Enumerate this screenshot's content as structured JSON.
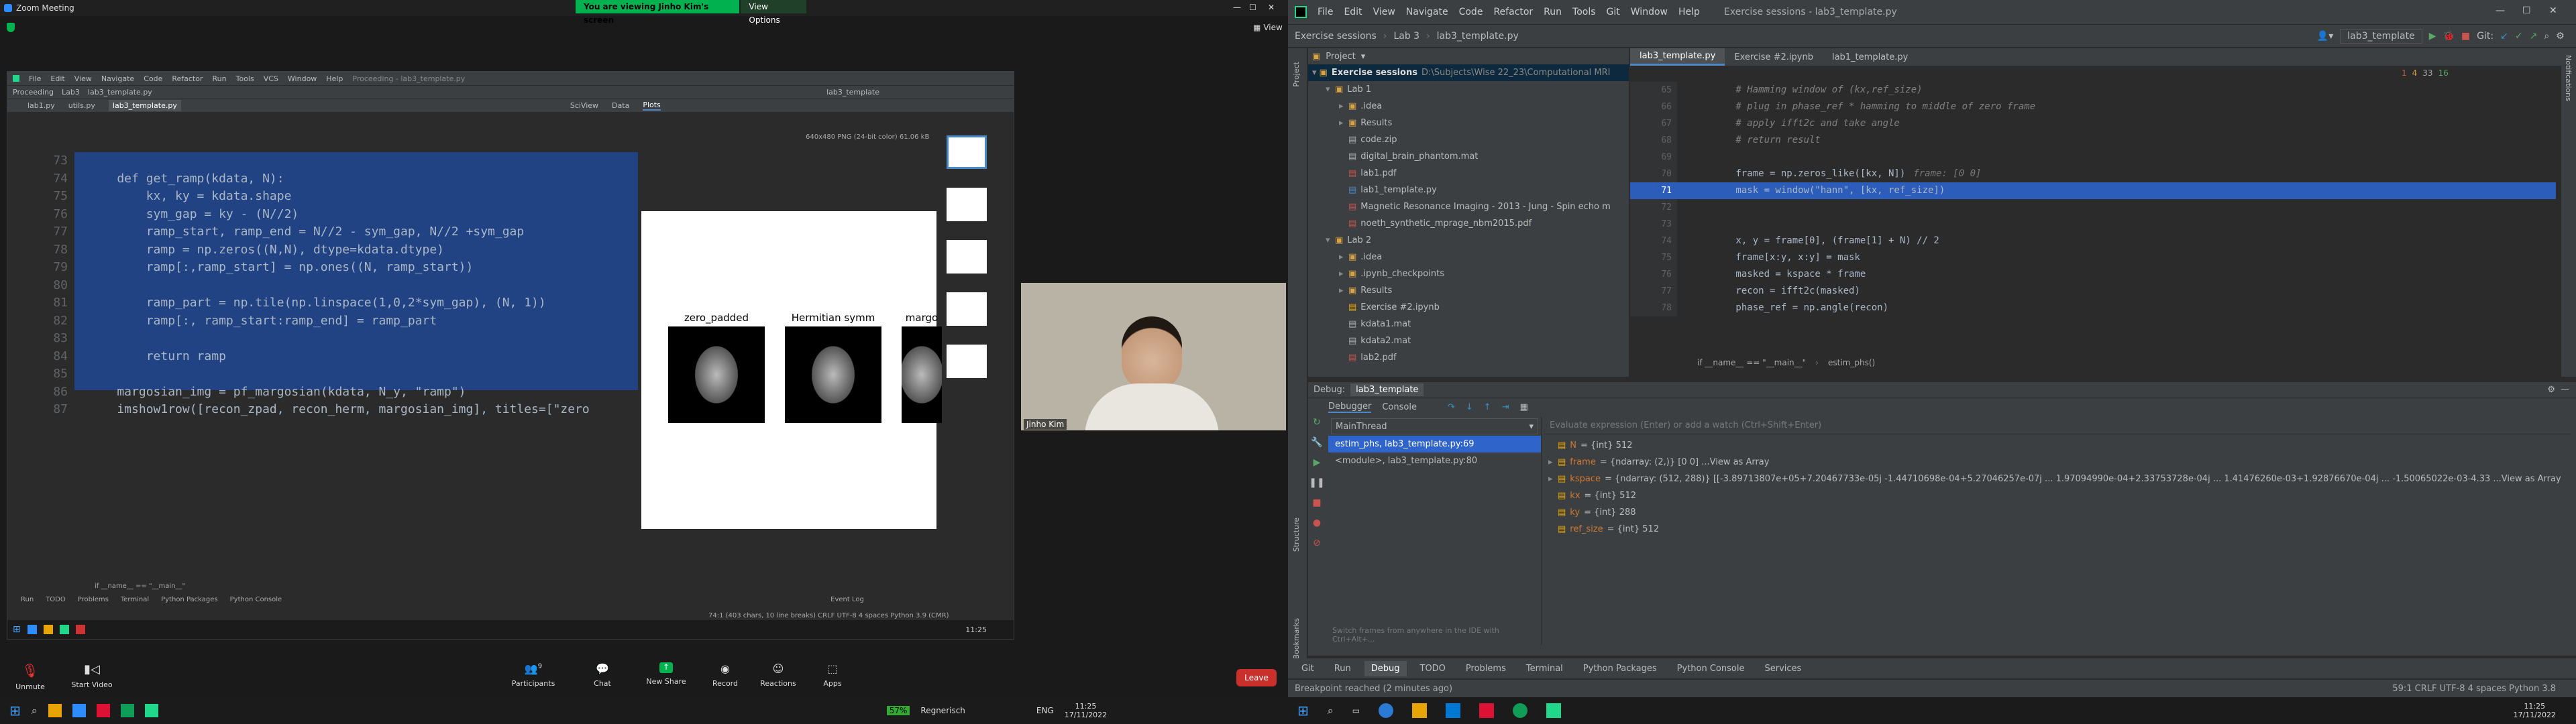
{
  "zoom": {
    "window_title": "Zoom Meeting",
    "banner_text": "You are viewing Jinho Kim's screen",
    "view_options": "View Options",
    "view_label": "View",
    "participant_name": "Jinho Kim",
    "toolbar": {
      "unmute": "Unmute",
      "start_video": "Start Video",
      "participants": "Participants",
      "participants_count": "9",
      "chat": "Chat",
      "share_screen": "New Share",
      "record": "Record",
      "reactions": "Reactions",
      "apps": "Apps",
      "leave": "Leave"
    },
    "shared_ide": {
      "menu": [
        "File",
        "Edit",
        "View",
        "Navigate",
        "Code",
        "Refactor",
        "Run",
        "Tools",
        "VCS",
        "Window",
        "Help"
      ],
      "title": "Proceeding - lab3_template.py",
      "breadcrumb": [
        "Proceeding",
        "Lab3",
        "lab3_template.py"
      ],
      "tabs": [
        "lab1.py",
        "utils.py",
        "lab3_template.py"
      ],
      "run_config": "lab3_template",
      "code_start_line": 73,
      "code": [
        "",
        "    def get_ramp(kdata, N):",
        "        kx, ky = kdata.shape",
        "        sym_gap = ky - (N//2)",
        "        ramp_start, ramp_end = N//2 - sym_gap, N//2 +sym_gap",
        "        ramp = np.zeros((N,N), dtype=kdata.dtype)",
        "        ramp[:,ramp_start] = np.ones((N, ramp_start))",
        "",
        "        ramp_part = np.tile(np.linspace(1,0,2*sym_gap), (N, 1))",
        "        ramp[:, ramp_start:ramp_end] = ramp_part",
        "",
        "        return ramp",
        "",
        "    margosian_img = pf_margosian(kdata, N_y, \"ramp\")",
        "    imshow1row([recon_zpad, recon_herm, margosian_img], titles=[\"zero"
      ],
      "breadcrumb_bottom": "if __name__ == \"__main__\"",
      "sciview_tabs": [
        "SciView",
        "Data",
        "Plots"
      ],
      "plot_info": "640x480 PNG (24-bit color) 61.06 kB",
      "plot_titles": [
        "zero_padded",
        "Hermitian symm",
        "margo"
      ],
      "bottom_tabs": [
        "Run",
        "TODO",
        "Problems",
        "Terminal",
        "Python Packages",
        "Python Console"
      ],
      "status": "74:1 (403 chars, 10 line breaks)   CRLF   UTF-8   4 spaces   Python 3.9 (CMR)",
      "event_log": "Event Log",
      "taskbar_time": "11:25"
    }
  },
  "right_ide": {
    "menu": [
      "File",
      "Edit",
      "View",
      "Navigate",
      "Code",
      "Refactor",
      "Run",
      "Tools",
      "Git",
      "Window",
      "Help"
    ],
    "title": "Exercise sessions - lab3_template.py",
    "breadcrumb": [
      "Exercise sessions",
      "Lab 3",
      "lab3_template.py"
    ],
    "run_config": "lab3_template",
    "git_label": "Git:",
    "project_label": "Project",
    "project_root": "Exercise sessions",
    "project_path": "D:\\Subjects\\Wise 22_23\\Computational MRI",
    "tree": [
      {
        "label": "Lab 1",
        "level": 1,
        "type": "folder",
        "open": true
      },
      {
        "label": ".idea",
        "level": 2,
        "type": "folder",
        "open": false
      },
      {
        "label": "Results",
        "level": 2,
        "type": "folder",
        "open": false
      },
      {
        "label": "code.zip",
        "level": 2,
        "type": "zip"
      },
      {
        "label": "digital_brain_phantom.mat",
        "level": 2,
        "type": "mat"
      },
      {
        "label": "lab1.pdf",
        "level": 2,
        "type": "pdf"
      },
      {
        "label": "lab1_template.py",
        "level": 2,
        "type": "py"
      },
      {
        "label": "Magnetic Resonance Imaging - 2013 - Jung - Spin echo m",
        "level": 2,
        "type": "pdf"
      },
      {
        "label": "noeth_synthetic_mprage_nbm2015.pdf",
        "level": 2,
        "type": "pdf"
      },
      {
        "label": "Lab 2",
        "level": 1,
        "type": "folder",
        "open": true
      },
      {
        "label": ".idea",
        "level": 2,
        "type": "folder",
        "open": false
      },
      {
        "label": ".ipynb_checkpoints",
        "level": 2,
        "type": "folder",
        "open": false
      },
      {
        "label": "Results",
        "level": 2,
        "type": "folder",
        "open": false
      },
      {
        "label": "Exercise #2.ipynb",
        "level": 2,
        "type": "ipynb"
      },
      {
        "label": "kdata1.mat",
        "level": 2,
        "type": "mat"
      },
      {
        "label": "kdata2.mat",
        "level": 2,
        "type": "mat"
      },
      {
        "label": "lab2.pdf",
        "level": 2,
        "type": "pdf"
      }
    ],
    "editor_tabs": [
      "lab3_template.py",
      "Exercise #2.ipynb",
      "lab1_template.py"
    ],
    "inspections": {
      "errors": "1",
      "warnings": "4",
      "weak": "33",
      "typos": "16"
    },
    "code_start_line": 65,
    "code": [
      {
        "text": "        # Hamming window of (kx,ref_size)",
        "cls": "cm"
      },
      {
        "text": "        # plug in phase_ref * hamming to middle of zero frame",
        "cls": "cm"
      },
      {
        "text": "        # apply ifft2c and take angle",
        "cls": "cm"
      },
      {
        "text": "        # return result",
        "cls": "cm"
      },
      {
        "text": "",
        "cls": "var"
      },
      {
        "text": "        frame = np.zeros_like([kx, N])",
        "cls": "var",
        "hint": "frame: [0 0]"
      },
      {
        "text": "        mask = window(\"hann\", [kx, ref_size])",
        "cls": "var",
        "current": true
      },
      {
        "text": "",
        "cls": "var"
      },
      {
        "text": "",
        "cls": "var"
      },
      {
        "text": "        x, y = frame[0], (frame[1] + N) // 2",
        "cls": "var"
      },
      {
        "text": "        frame[x:y, x:y] = mask",
        "cls": "var"
      },
      {
        "text": "        masked = kspace * frame",
        "cls": "var"
      },
      {
        "text": "        recon = ifft2c(masked)",
        "cls": "var"
      },
      {
        "text": "        phase_ref = np.angle(recon)",
        "cls": "var"
      }
    ],
    "editor_breadcrumb": [
      "if __name__ == \"__main__\"",
      "estim_phs()"
    ],
    "debug": {
      "label": "Debug:",
      "config": "lab3_template",
      "tabs": [
        "Debugger",
        "Console"
      ],
      "thread": "MainThread",
      "frames": [
        "estim_phs, lab3_template.py:69",
        "<module>, lab3_template.py:80"
      ],
      "eval_placeholder": "Evaluate expression (Enter) or add a watch (Ctrl+Shift+Enter)",
      "variables": [
        {
          "name": "N",
          "value": "= {int} 512",
          "expandable": false
        },
        {
          "name": "frame",
          "value": "= {ndarray: (2,)} [0 0] ...View as Array",
          "expandable": true
        },
        {
          "name": "kspace",
          "value": "= {ndarray: (512, 288)} [[-3.89713807e+05+7.20467733e-05j -1.44710698e-04+5.27046257e-07j ... 1.97094990e-04+2.33753728e-04j ... 1.41476260e-03+1.92876670e-04j ... -1.50065022e-03-4.33 ...View as Array",
          "expandable": true
        },
        {
          "name": "kx",
          "value": "= {int} 512",
          "expandable": false
        },
        {
          "name": "ky",
          "value": "= {int} 288",
          "expandable": false
        },
        {
          "name": "ref_size",
          "value": "= {int} 512",
          "expandable": false
        }
      ],
      "switch_frames_hint": "Switch frames from anywhere in the IDE with Ctrl+Alt+..."
    },
    "bottom_tabs": [
      "Git",
      "Run",
      "Debug",
      "TODO",
      "Problems",
      "Terminal",
      "Python Packages",
      "Python Console",
      "Services"
    ],
    "status_left": "Breakpoint reached (2 minutes ago)",
    "status_right": "59:1   CRLF   UTF-8   4 spaces   Python 3.8"
  },
  "left_taskbar": {
    "battery": "57%",
    "weather": "Regnerisch",
    "lang": "ENG",
    "time": "11:25",
    "date": "17/11/2022"
  },
  "right_taskbar": {
    "time": "11:25",
    "date": "17/11/2022"
  },
  "colors": {
    "zoom_green": "#00b14f",
    "debug_line": "#2d5dbb",
    "selection": "#214283",
    "leave_red": "#c9302c"
  }
}
